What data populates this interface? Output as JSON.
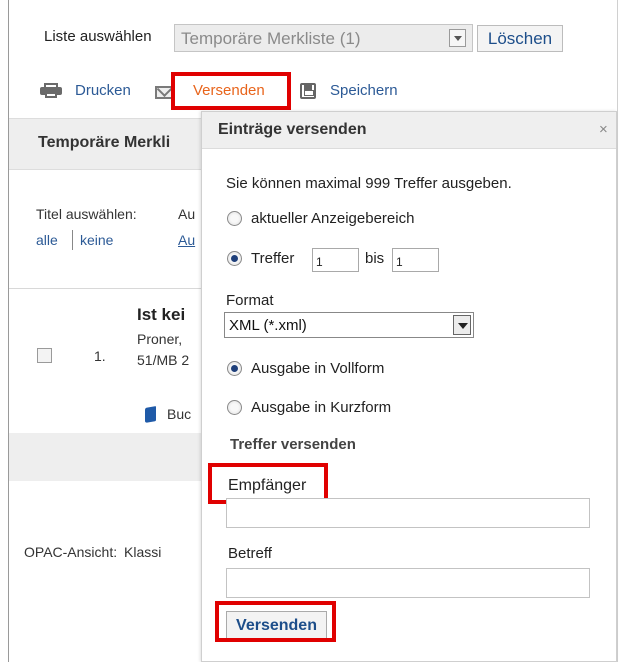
{
  "top": {
    "list_label": "Liste auswählen",
    "list_selected": "Temporäre Merkliste (1)",
    "delete_label": "Löschen"
  },
  "toolbar": {
    "print_label": "Drucken",
    "send_label": "Versenden",
    "save_label": "Speichern"
  },
  "list_panel": {
    "heading": "Temporäre Merkli",
    "select_titles_label": "Titel auswählen:",
    "select_titles_trail": "Au",
    "all_link": "alle",
    "none_link": "keine",
    "action_link_partial": "Au"
  },
  "result": {
    "title_partial": "Ist kei",
    "author_partial": "Proner,",
    "shelfmark_partial": "51/MB 2",
    "number": "1.",
    "media_type_partial": "Buc"
  },
  "footer": {
    "opac_view_label": "OPAC-Ansicht:",
    "opac_view_value_partial": "Klassi"
  },
  "dialog": {
    "title": "Einträge versenden",
    "close_symbol": "×",
    "max_hits_text": "Sie können maximal 999 Treffer ausgeben.",
    "range_current_label": "aktueller Anzeigebereich",
    "range_hits_label": "Treffer",
    "range_from_value": "1",
    "range_to_label": "bis",
    "range_to_value": "1",
    "format_label": "Format",
    "format_selected": "XML (*.xml)",
    "full_form_label": "Ausgabe in Vollform",
    "short_form_label": "Ausgabe in Kurzform",
    "send_hits_heading": "Treffer versenden",
    "recipient_label": "Empfänger",
    "recipient_value": "",
    "subject_label": "Betreff",
    "subject_value": "",
    "send_button_label": "Versenden"
  },
  "colors": {
    "link": "#2c5a96",
    "highlight": "#e00000",
    "send_active": "#e8641b"
  }
}
